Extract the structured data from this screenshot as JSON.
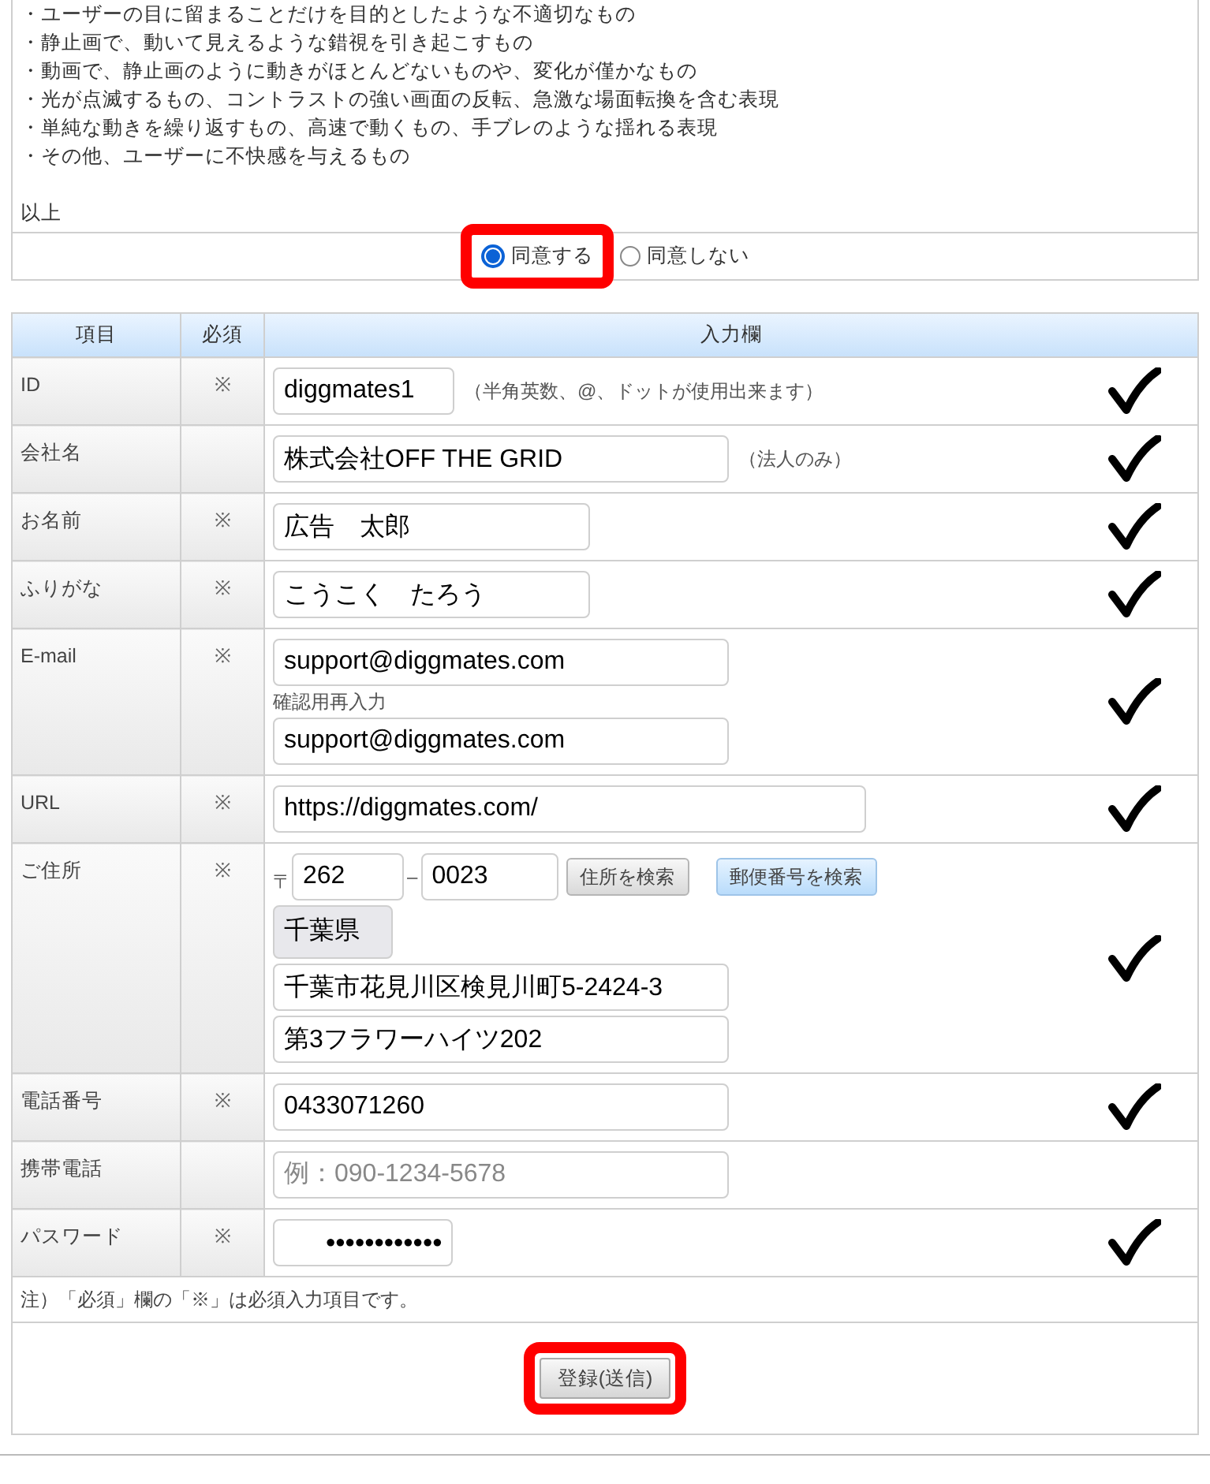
{
  "notice": {
    "lines": [
      "・ユーザーの目に留まることだけを目的としたような不適切なもの",
      "・静止画で、動いて見えるような錯視を引き起こすもの",
      "・動画で、静止画のように動きがほとんどないものや、変化が僅かなもの",
      "・光が点滅するもの、コントラストの強い画面の反転、急激な場面転換を含む表現",
      "・単純な動きを繰り返すもの、高速で動くもの、手ブレのような揺れる表現",
      "・その他、ユーザーに不快感を与えるもの"
    ],
    "closing": "以上"
  },
  "consent": {
    "highlighted": true,
    "options": [
      {
        "label": "同意する",
        "selected": true
      },
      {
        "label": "同意しない",
        "selected": false
      }
    ]
  },
  "table": {
    "columns": [
      "項目",
      "必須",
      "入力欄"
    ],
    "rows": [
      {
        "kind": "id",
        "label": "ID",
        "required_mark": "※",
        "valid": true,
        "value": "diggmates1",
        "hint": "（半角英数、@、ドットが使用出来ます）"
      },
      {
        "kind": "company",
        "label": "会社名",
        "valid": true,
        "value": "株式会社OFF THE GRID",
        "hint": "（法人のみ）"
      },
      {
        "kind": "name",
        "label": "お名前",
        "required_mark": "※",
        "valid": true,
        "value": "広告　太郎"
      },
      {
        "kind": "kana",
        "label": "ふりがな",
        "required_mark": "※",
        "valid": true,
        "value": "こうこく　たろう"
      },
      {
        "kind": "email",
        "label": "E-mail",
        "required_mark": "※",
        "valid": true,
        "value": "support@diggmates.com",
        "caption": "確認用再入力",
        "confirm_value": "support@diggmates.com"
      },
      {
        "kind": "url",
        "label": "URL",
        "required_mark": "※",
        "valid": true,
        "value": "https://diggmates.com/"
      },
      {
        "kind": "address",
        "label": "ご住所",
        "required_mark": "※",
        "valid": true,
        "postal_mark": "〒",
        "zip1": "262",
        "separator": "–",
        "zip2": "0023",
        "buttons": [
          {
            "label": "住所を検索",
            "highlighted": false
          },
          {
            "label": "郵便番号を検索",
            "highlighted": true
          }
        ],
        "prefecture": "千葉県",
        "city": "千葉市花見川区検見川町5-2424-3",
        "building": "第3フラワーハイツ202"
      },
      {
        "kind": "phone",
        "label": "電話番号",
        "required_mark": "※",
        "valid": true,
        "value": "0433071260"
      },
      {
        "kind": "mobile",
        "label": "携帯電話",
        "valid": false,
        "placeholder": "例：090-1234-5678"
      },
      {
        "kind": "password",
        "label": "パスワード",
        "required_mark": "※",
        "valid": true,
        "value": "●●●●●●●●●●●●"
      }
    ],
    "note": "注）「必須」欄の「※」は必須入力項目です。"
  },
  "submit": {
    "label": "登録(送信)",
    "highlighted": true
  }
}
